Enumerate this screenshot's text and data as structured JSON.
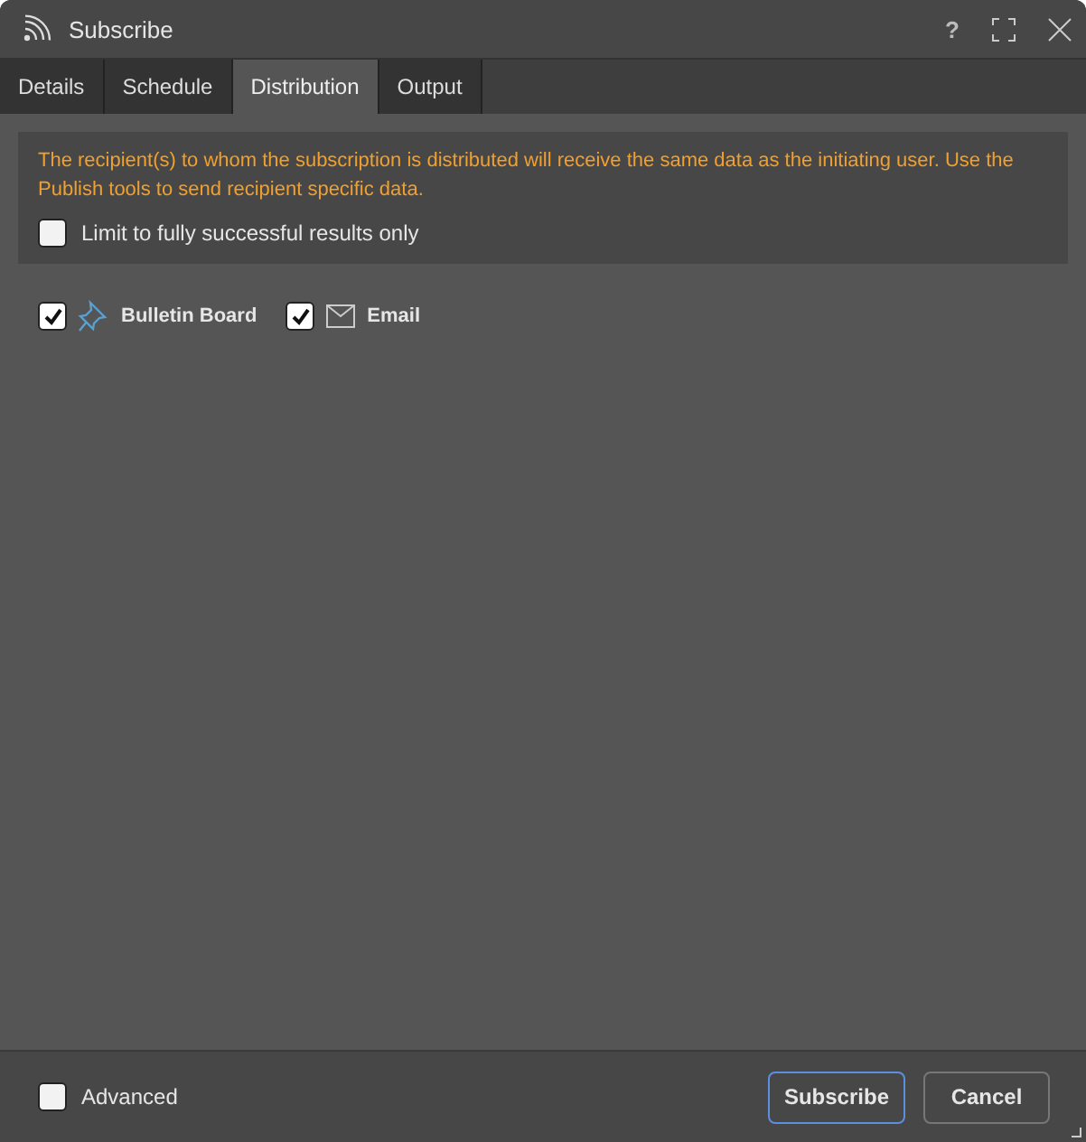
{
  "window": {
    "title": "Subscribe",
    "help": "?"
  },
  "tabs": [
    {
      "label": "Details",
      "selected": false
    },
    {
      "label": "Schedule",
      "selected": false
    },
    {
      "label": "Distribution",
      "selected": true
    },
    {
      "label": "Output",
      "selected": false
    }
  ],
  "notice": {
    "message": "The recipient(s) to whom the subscription is distributed will receive the same data as the initiating user. Use the Publish tools to send recipient specific data.",
    "limit": {
      "label": "Limit to fully successful results only",
      "checked": false
    }
  },
  "channels": [
    {
      "kind": "pin",
      "label": "Bulletin Board",
      "checked": true
    },
    {
      "kind": "mail",
      "label": "Email",
      "checked": true
    }
  ],
  "footer": {
    "advanced": {
      "label": "Advanced",
      "checked": false
    },
    "buttons": [
      {
        "label": "Subscribe",
        "focused": true
      },
      {
        "label": "Cancel",
        "focused": false
      }
    ]
  }
}
